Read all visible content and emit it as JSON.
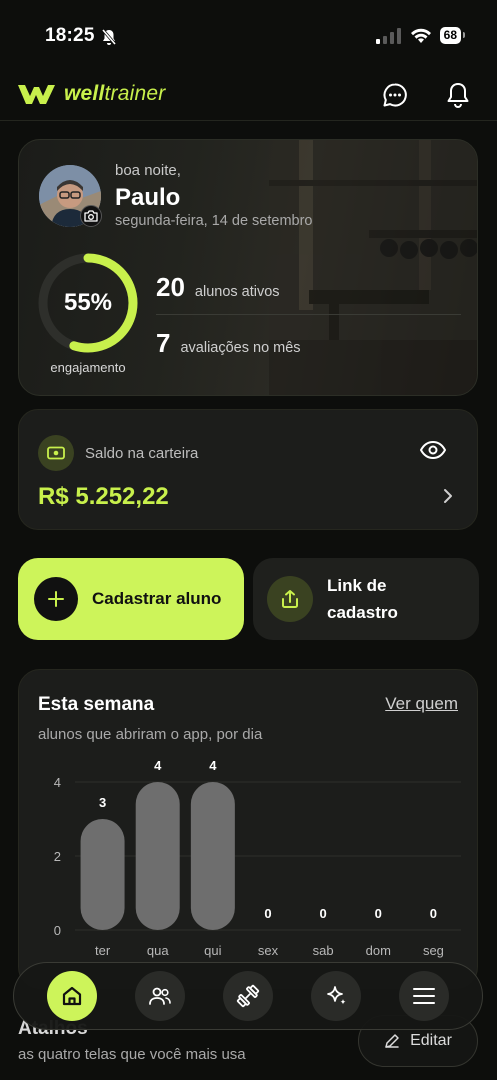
{
  "status_bar": {
    "time": "18:25",
    "battery": "68"
  },
  "header": {
    "brand_bold": "well",
    "brand_regular": "trainer",
    "icons": [
      "chat-icon",
      "bell-icon"
    ]
  },
  "profile": {
    "greeting": "boa noite,",
    "name": "Paulo",
    "date": "segunda-feira, 14 de setembro",
    "engagement_pct": "55%",
    "engagement_value": 0.55,
    "engagement_label": "engajamento",
    "stats": [
      {
        "value": "20",
        "label": "alunos ativos"
      },
      {
        "value": "7",
        "label": "avaliações no mês"
      }
    ]
  },
  "wallet": {
    "label": "Saldo na carteira",
    "amount": "R$ 5.252,22"
  },
  "actions": {
    "primary_label": "Cadastrar aluno",
    "secondary_label": "Link de cadastro"
  },
  "week": {
    "title": "Esta semana",
    "link": "Ver quem",
    "subtitle": "alunos que abriram o app, por dia"
  },
  "chart_data": {
    "type": "bar",
    "categories": [
      "ter",
      "qua",
      "qui",
      "sex",
      "sab",
      "dom",
      "seg"
    ],
    "values": [
      3,
      4,
      4,
      0,
      0,
      0,
      0
    ],
    "yticks": [
      "0",
      "2",
      "4"
    ],
    "ylim": [
      0,
      4
    ],
    "grid": true,
    "bar_color": "#6e6e6e"
  },
  "atalhos": {
    "title": "Atalhos",
    "subtitle": "as quatro telas que você mais usa",
    "edit_label": "Editar"
  },
  "nav": {
    "items": [
      "home-icon",
      "students-icon",
      "workout-icon",
      "sparkle-icon",
      "menu-icon"
    ],
    "active": 0
  },
  "colors": {
    "accent": "#c8f04c",
    "background": "#0d0e0c",
    "card": "#1c1d1b"
  }
}
